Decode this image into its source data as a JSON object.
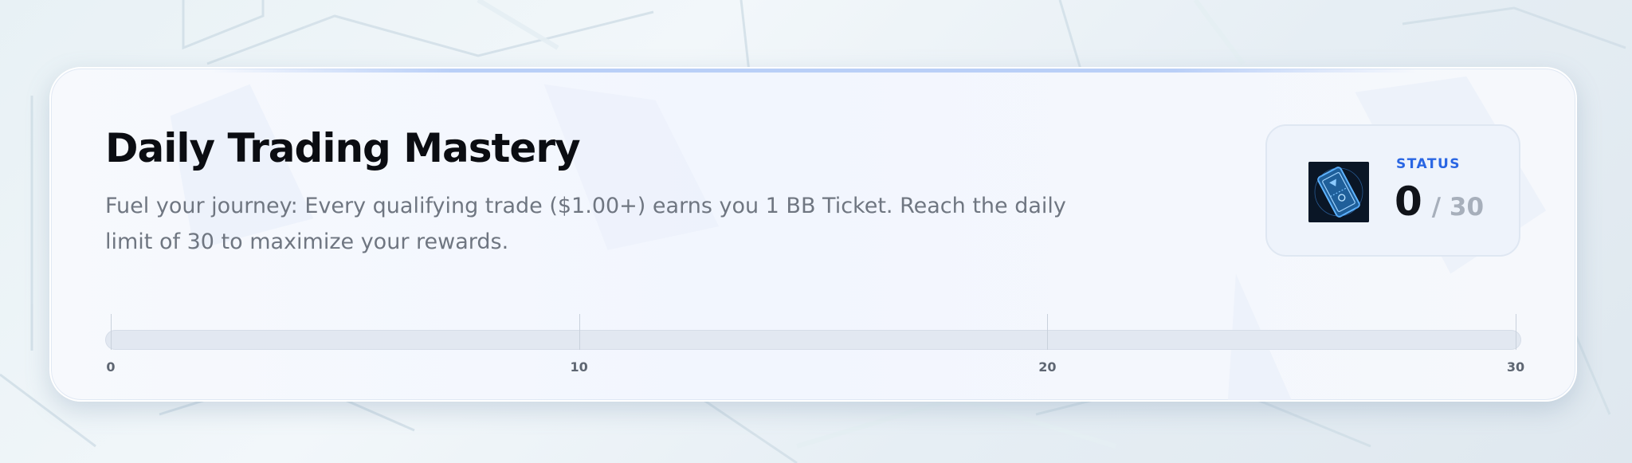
{
  "card": {
    "title": "Daily Trading Mastery",
    "description": "Fuel your journey: Every qualifying trade ($1.00+) earns you 1 BB Ticket. Reach the daily limit of 30 to maximize your rewards."
  },
  "status": {
    "label": "STATUS",
    "current": "0",
    "max_display": "/ 30",
    "icon": "bb-ticket-icon"
  },
  "progress": {
    "value": 0,
    "max": 30,
    "ticks": [
      {
        "label": "0",
        "value": 0
      },
      {
        "label": "10",
        "value": 10
      },
      {
        "label": "20",
        "value": 20
      },
      {
        "label": "30",
        "value": 30
      }
    ]
  },
  "colors": {
    "accent": "#2a66e3",
    "title": "#0b0d12",
    "text_muted": "#6f7681",
    "track": "#e2e8f1"
  }
}
